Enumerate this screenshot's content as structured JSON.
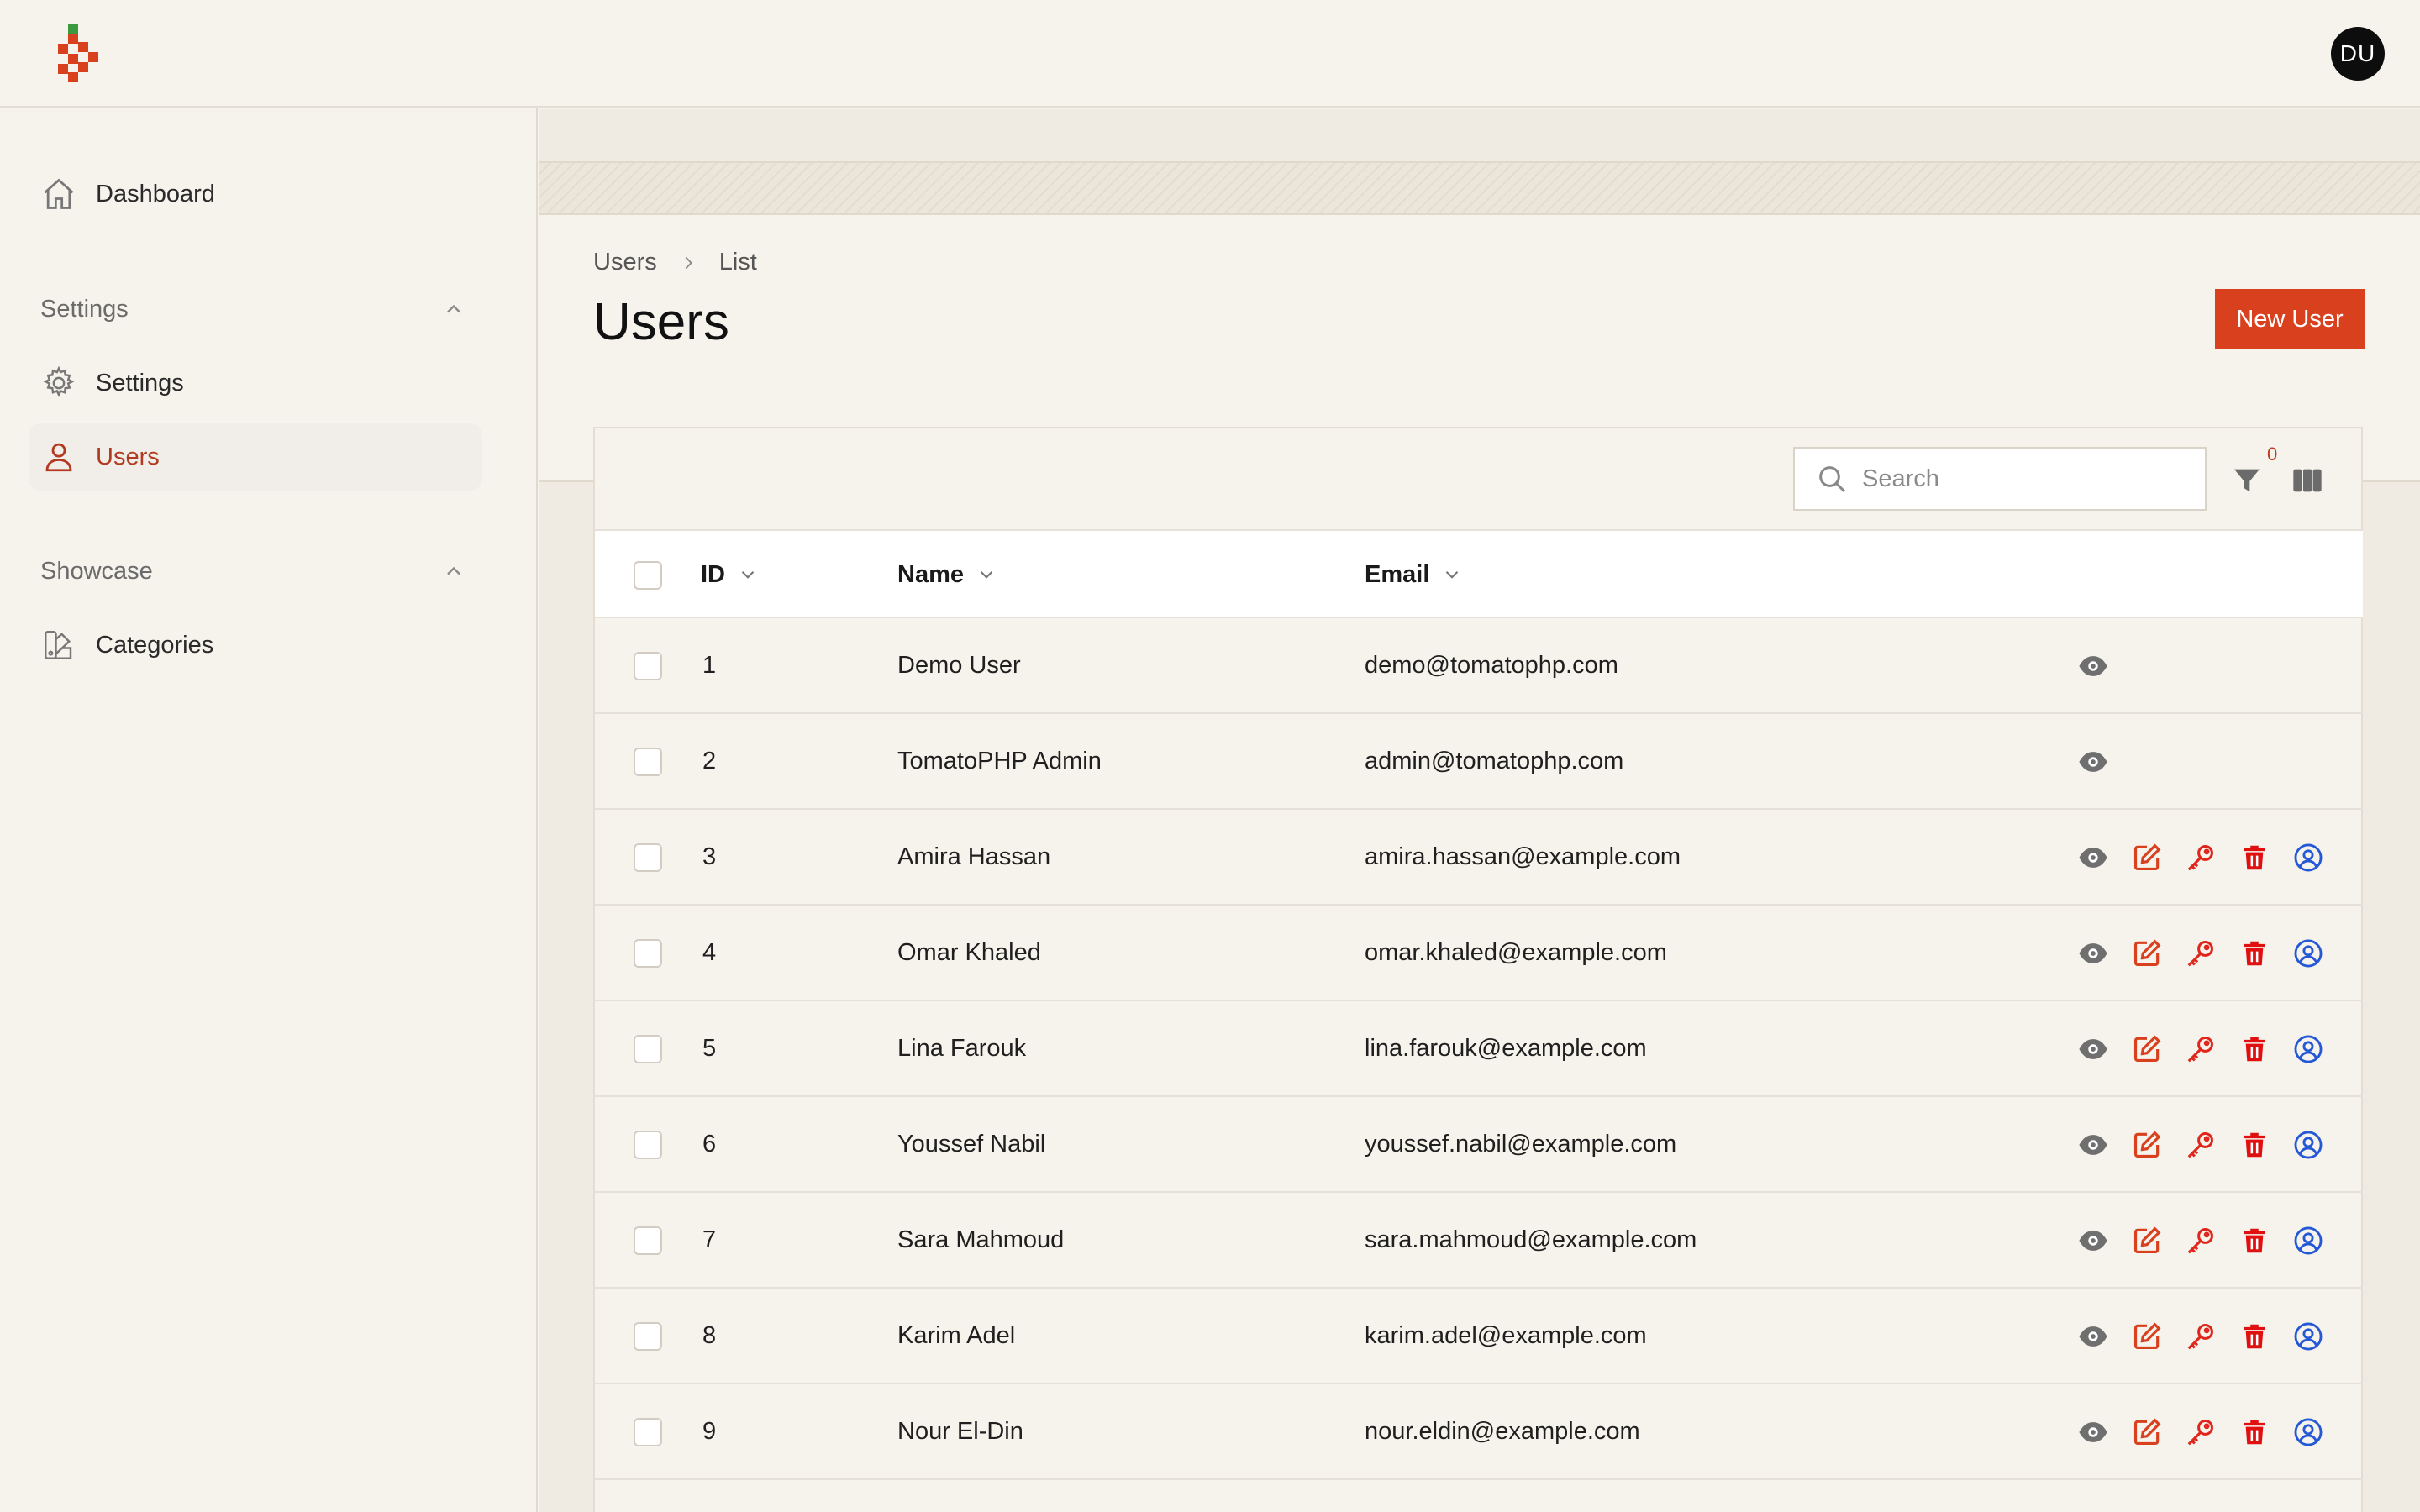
{
  "header": {
    "avatar_initials": "DU"
  },
  "sidebar": {
    "dashboard": {
      "label": "Dashboard",
      "icon": "home-icon"
    },
    "groups": [
      {
        "label": "Settings",
        "items": [
          {
            "label": "Settings",
            "icon": "gear-icon"
          },
          {
            "label": "Users",
            "icon": "user-icon",
            "active": true
          }
        ]
      },
      {
        "label": "Showcase",
        "items": [
          {
            "label": "Categories",
            "icon": "swatch-icon"
          }
        ]
      }
    ]
  },
  "page": {
    "breadcrumb": [
      "Users",
      "List"
    ],
    "title": "Users",
    "new_button": "New User"
  },
  "table": {
    "search_placeholder": "Search",
    "filter_count": "0",
    "columns": [
      "ID",
      "Name",
      "Email"
    ],
    "rows": [
      {
        "id": "1",
        "name": "Demo User",
        "email": "demo@tomatophp.com",
        "actions": [
          "view"
        ]
      },
      {
        "id": "2",
        "name": "TomatoPHP Admin",
        "email": "admin@tomatophp.com",
        "actions": [
          "view"
        ]
      },
      {
        "id": "3",
        "name": "Amira Hassan",
        "email": "amira.hassan@example.com",
        "actions": [
          "view",
          "edit",
          "password",
          "delete",
          "impersonate"
        ]
      },
      {
        "id": "4",
        "name": "Omar Khaled",
        "email": "omar.khaled@example.com",
        "actions": [
          "view",
          "edit",
          "password",
          "delete",
          "impersonate"
        ]
      },
      {
        "id": "5",
        "name": "Lina Farouk",
        "email": "lina.farouk@example.com",
        "actions": [
          "view",
          "edit",
          "password",
          "delete",
          "impersonate"
        ]
      },
      {
        "id": "6",
        "name": "Youssef Nabil",
        "email": "youssef.nabil@example.com",
        "actions": [
          "view",
          "edit",
          "password",
          "delete",
          "impersonate"
        ]
      },
      {
        "id": "7",
        "name": "Sara Mahmoud",
        "email": "sara.mahmoud@example.com",
        "actions": [
          "view",
          "edit",
          "password",
          "delete",
          "impersonate"
        ]
      },
      {
        "id": "8",
        "name": "Karim Adel",
        "email": "karim.adel@example.com",
        "actions": [
          "view",
          "edit",
          "password",
          "delete",
          "impersonate"
        ]
      },
      {
        "id": "9",
        "name": "Nour El-Din",
        "email": "nour.eldin@example.com",
        "actions": [
          "view",
          "edit",
          "password",
          "delete",
          "impersonate"
        ]
      }
    ]
  },
  "colors": {
    "accent": "#d9401e",
    "active_text": "#b23a20",
    "view_icon": "#6f6f6f",
    "edit_icon": "#d9401e",
    "key_icon": "#e0261b",
    "delete_icon": "#e01010",
    "impersonate_icon": "#2458d6"
  }
}
